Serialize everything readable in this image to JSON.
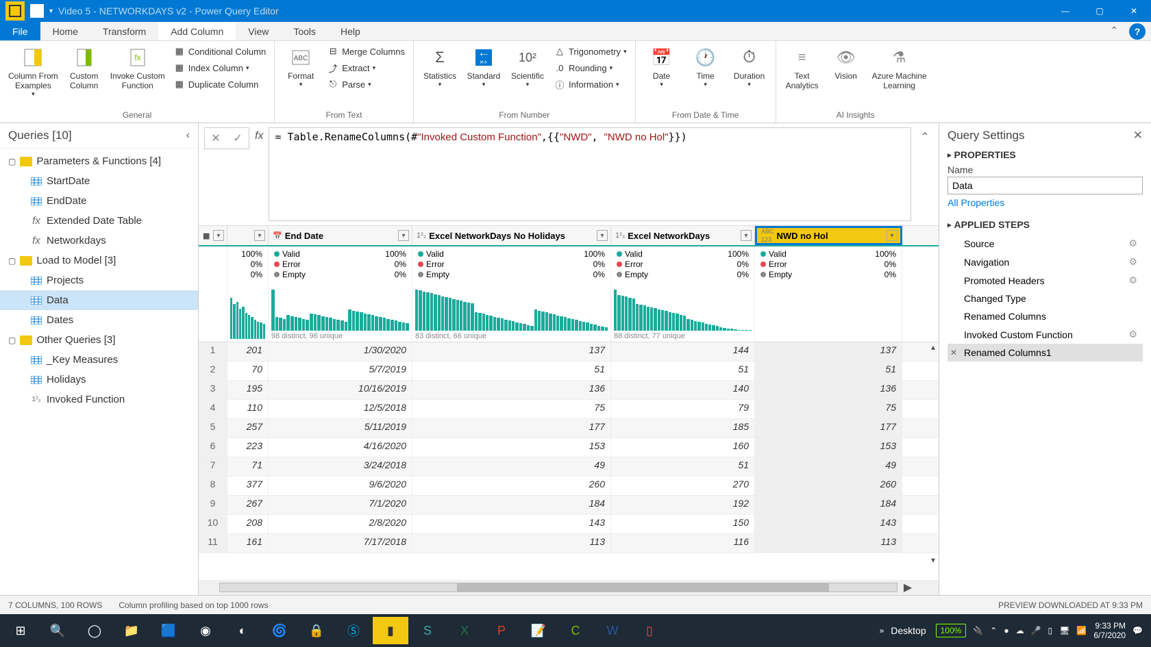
{
  "title_bar": {
    "text": "Video 5 - NETWORKDAYS v2 - Power Query Editor"
  },
  "menu": {
    "file": "File",
    "home": "Home",
    "transform": "Transform",
    "add_column": "Add Column",
    "view": "View",
    "tools": "Tools",
    "help": "Help"
  },
  "ribbon": {
    "general": {
      "label": "General",
      "col_examples": "Column From\nExamples",
      "custom_col": "Custom\nColumn",
      "invoke_fn": "Invoke Custom\nFunction",
      "cond_col": "Conditional Column",
      "index_col": "Index Column",
      "dup_col": "Duplicate Column"
    },
    "from_text": {
      "label": "From Text",
      "format": "Format",
      "merge": "Merge Columns",
      "extract": "Extract",
      "parse": "Parse"
    },
    "from_number": {
      "label": "From Number",
      "stats": "Statistics",
      "standard": "Standard",
      "scientific": "Scientific",
      "trig": "Trigonometry",
      "round": "Rounding",
      "info": "Information"
    },
    "from_date": {
      "label": "From Date & Time",
      "date": "Date",
      "time": "Time",
      "duration": "Duration"
    },
    "ai": {
      "label": "AI Insights",
      "text_analytics": "Text\nAnalytics",
      "vision": "Vision",
      "aml": "Azure Machine\nLearning"
    }
  },
  "queries_panel": {
    "header": "Queries [10]",
    "folders": [
      {
        "name": "Parameters & Functions [4]",
        "items": [
          {
            "label": "StartDate",
            "icon": "table"
          },
          {
            "label": "EndDate",
            "icon": "table"
          },
          {
            "label": "Extended Date Table",
            "icon": "fx"
          },
          {
            "label": "Networkdays",
            "icon": "fx"
          }
        ]
      },
      {
        "name": "Load to Model [3]",
        "items": [
          {
            "label": "Projects",
            "icon": "table"
          },
          {
            "label": "Data",
            "icon": "table",
            "selected": true
          },
          {
            "label": "Dates",
            "icon": "table"
          }
        ]
      },
      {
        "name": "Other Queries [3]",
        "items": [
          {
            "label": "_Key Measures",
            "icon": "table"
          },
          {
            "label": "Holidays",
            "icon": "table"
          },
          {
            "label": "Invoked Function",
            "icon": "123"
          }
        ]
      }
    ]
  },
  "formula": "= Table.RenameColumns(#\"Invoked Custom Function\",{{\"NWD\", \"NWD no Hol\"}})",
  "table": {
    "columns": [
      {
        "name": "",
        "type": "any"
      },
      {
        "name": "End Date",
        "type": "date"
      },
      {
        "name": "Excel NetworkDays No Holidays",
        "type": "123"
      },
      {
        "name": "Excel NetworkDays",
        "type": "123"
      },
      {
        "name": "NWD no Hol",
        "type": "abc123",
        "selected": true
      }
    ],
    "quality": {
      "valid": "Valid",
      "error": "Error",
      "empty": "Empty",
      "pct100": "100%",
      "pct0": "0%"
    },
    "distinct": [
      "",
      "98 distinct, 96 unique",
      "83 distinct, 66 unique",
      "88 distinct, 77 unique",
      ""
    ],
    "rows": [
      {
        "n": 1,
        "c1": "201",
        "c2": "1/30/2020",
        "c3": "137",
        "c4": "144",
        "c5": "137"
      },
      {
        "n": 2,
        "c1": "70",
        "c2": "5/7/2019",
        "c3": "51",
        "c4": "51",
        "c5": "51"
      },
      {
        "n": 3,
        "c1": "195",
        "c2": "10/16/2019",
        "c3": "136",
        "c4": "140",
        "c5": "136"
      },
      {
        "n": 4,
        "c1": "110",
        "c2": "12/5/2018",
        "c3": "75",
        "c4": "79",
        "c5": "75"
      },
      {
        "n": 5,
        "c1": "257",
        "c2": "5/11/2019",
        "c3": "177",
        "c4": "185",
        "c5": "177"
      },
      {
        "n": 6,
        "c1": "223",
        "c2": "4/16/2020",
        "c3": "153",
        "c4": "160",
        "c5": "153"
      },
      {
        "n": 7,
        "c1": "71",
        "c2": "3/24/2018",
        "c3": "49",
        "c4": "51",
        "c5": "49"
      },
      {
        "n": 8,
        "c1": "377",
        "c2": "9/6/2020",
        "c3": "260",
        "c4": "270",
        "c5": "260"
      },
      {
        "n": 9,
        "c1": "267",
        "c2": "7/1/2020",
        "c3": "184",
        "c4": "192",
        "c5": "184"
      },
      {
        "n": 10,
        "c1": "208",
        "c2": "2/8/2020",
        "c3": "143",
        "c4": "150",
        "c5": "143"
      },
      {
        "n": 11,
        "c1": "161",
        "c2": "7/17/2018",
        "c3": "113",
        "c4": "116",
        "c5": "113"
      }
    ]
  },
  "settings": {
    "header": "Query Settings",
    "properties": "PROPERTIES",
    "name_label": "Name",
    "name_value": "Data",
    "all_props": "All Properties",
    "applied_steps": "APPLIED STEPS",
    "steps": [
      {
        "label": "Source",
        "gear": true
      },
      {
        "label": "Navigation",
        "gear": true
      },
      {
        "label": "Promoted Headers",
        "gear": true
      },
      {
        "label": "Changed Type"
      },
      {
        "label": "Renamed Columns"
      },
      {
        "label": "Invoked Custom Function",
        "gear": true
      },
      {
        "label": "Renamed Columns1",
        "selected": true
      }
    ]
  },
  "status": {
    "left1": "7 COLUMNS, 100 ROWS",
    "left2": "Column profiling based on top 1000 rows",
    "right": "PREVIEW DOWNLOADED AT 9:33 PM"
  },
  "taskbar": {
    "desktop": "Desktop",
    "battery": "100%",
    "time": "9:33 PM",
    "date": "6/7/2020"
  },
  "chart_data": [
    {
      "type": "bar",
      "title": "Column 1 distribution",
      "values": [
        95,
        80,
        85,
        70,
        75,
        60,
        55,
        50,
        45,
        40,
        38,
        35
      ],
      "xlabel": "",
      "ylabel": ""
    },
    {
      "type": "bar",
      "title": "End Date distribution",
      "values": [
        90,
        30,
        28,
        25,
        35,
        32,
        30,
        28,
        26,
        24,
        38,
        36,
        34,
        32,
        30,
        28,
        26,
        24,
        22,
        20,
        46,
        44,
        42,
        40,
        38,
        36,
        34,
        32,
        30,
        28,
        26,
        24,
        22,
        20,
        18,
        16
      ],
      "xlabel": "",
      "ylabel": ""
    },
    {
      "type": "bar",
      "title": "Excel NetworkDays No Holidays distribution",
      "values": [
        88,
        86,
        84,
        82,
        80,
        78,
        76,
        74,
        72,
        70,
        68,
        66,
        64,
        62,
        60,
        58,
        40,
        38,
        36,
        34,
        32,
        30,
        28,
        26,
        24,
        22,
        20,
        18,
        16,
        14,
        12,
        10,
        45,
        43,
        41,
        39,
        37,
        35,
        33,
        31,
        29,
        27,
        25,
        23,
        21,
        19,
        17,
        15,
        13,
        11,
        9,
        7
      ],
      "xlabel": "",
      "ylabel": ""
    },
    {
      "type": "bar",
      "title": "Excel NetworkDays distribution",
      "values": [
        92,
        80,
        78,
        76,
        74,
        72,
        60,
        58,
        56,
        54,
        52,
        50,
        48,
        46,
        44,
        42,
        40,
        38,
        36,
        34,
        26,
        24,
        22,
        20,
        18,
        16,
        14,
        12,
        10,
        8,
        6,
        5,
        4,
        3,
        2,
        2,
        2,
        2
      ],
      "xlabel": "",
      "ylabel": ""
    }
  ]
}
